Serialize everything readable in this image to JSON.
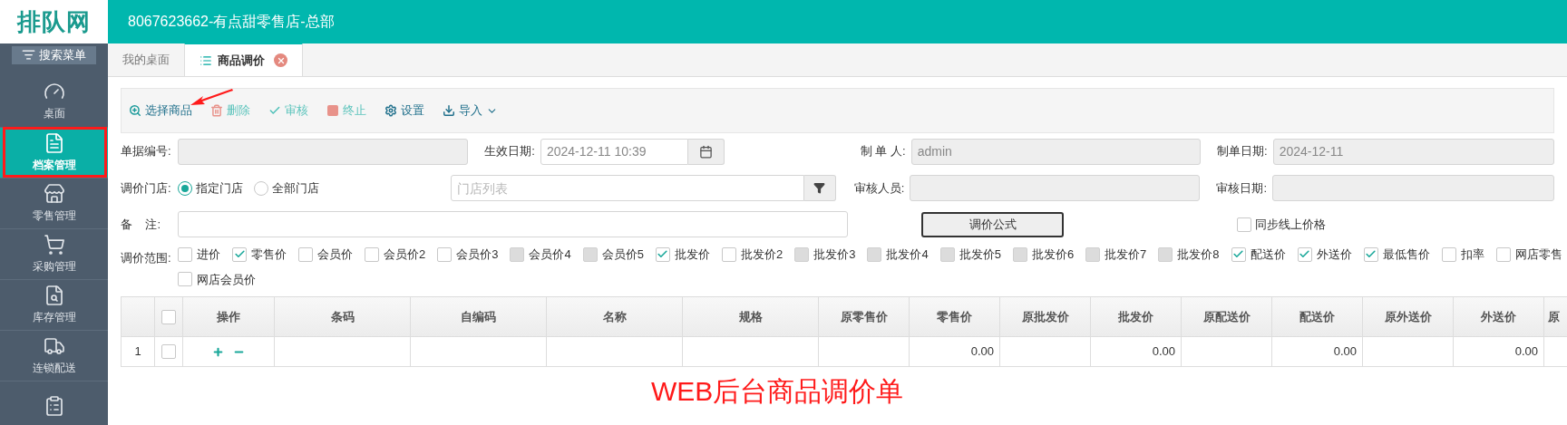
{
  "header": {
    "logo": "排队网",
    "title": "8067623662-有点甜零售店-总部"
  },
  "sidebar": {
    "search_button": "搜索菜单",
    "items": [
      {
        "label": "桌面",
        "selected": false,
        "annotated": false
      },
      {
        "label": "档案管理",
        "selected": true,
        "annotated": true
      },
      {
        "label": "零售管理",
        "selected": false,
        "annotated": false
      },
      {
        "label": "采购管理",
        "selected": false,
        "annotated": false
      },
      {
        "label": "库存管理",
        "selected": false,
        "annotated": false
      },
      {
        "label": "连锁配送",
        "selected": false,
        "annotated": false
      },
      {
        "selected": false,
        "annotated": false
      }
    ]
  },
  "tabs": [
    {
      "label": "我的桌面",
      "selected": false,
      "closable": false
    },
    {
      "label": "商品调价",
      "selected": true,
      "closable": true
    }
  ],
  "toolbar": [
    {
      "label": "选择商品",
      "disabled": false,
      "annotated": true,
      "dropdown": false
    },
    {
      "label": "删除",
      "disabled": true,
      "annotated": false,
      "dropdown": false
    },
    {
      "label": "审核",
      "disabled": true,
      "annotated": false,
      "dropdown": false
    },
    {
      "label": "终止",
      "disabled": true,
      "annotated": false,
      "dropdown": false
    },
    {
      "label": "设置",
      "disabled": false,
      "annotated": false,
      "dropdown": false
    },
    {
      "label": "导入",
      "disabled": false,
      "annotated": false,
      "dropdown": true
    }
  ],
  "form": {
    "doc_number": {
      "label": "单据编号:",
      "readonly": true
    },
    "effective_date": {
      "label": "生效日期:",
      "value": "2024-12-11 10:39",
      "readonly": false
    },
    "creator": {
      "label": "制 单 人:",
      "value": "admin",
      "readonly": true
    },
    "created_date": {
      "label": "制单日期:",
      "value": "2024-12-11",
      "readonly": true
    },
    "store_scope": {
      "label": "调价门店:",
      "options": [
        {
          "label": "指定门店",
          "selected": true
        },
        {
          "label": "全部门店",
          "selected": false
        }
      ]
    },
    "store_list": {
      "placeholder": "门店列表",
      "readonly": false
    },
    "reviewer": {
      "label": "审核人员:",
      "readonly": true
    },
    "review_date": {
      "label": "审核日期:",
      "readonly": true
    },
    "remark": {
      "label": "备    注:",
      "readonly": false
    },
    "formula_button": "调价公式",
    "sync_online": {
      "label": "同步线上价格",
      "checked": false
    }
  },
  "price_scope": {
    "label": "调价范围:",
    "rows": [
      [
        {
          "label": "进价",
          "checked": false,
          "disabled": false
        },
        {
          "label": "零售价",
          "checked": true,
          "disabled": false
        },
        {
          "label": "会员价",
          "checked": false,
          "disabled": false
        },
        {
          "label": "会员价2",
          "checked": false,
          "disabled": false
        },
        {
          "label": "会员价3",
          "checked": false,
          "disabled": false
        },
        {
          "label": "会员价4",
          "checked": false,
          "disabled": true
        },
        {
          "label": "会员价5",
          "checked": false,
          "disabled": true
        },
        {
          "label": "批发价",
          "checked": true,
          "disabled": false
        },
        {
          "label": "批发价2",
          "checked": false,
          "disabled": false
        },
        {
          "label": "批发价3",
          "checked": false,
          "disabled": true
        },
        {
          "label": "批发价4",
          "checked": false,
          "disabled": true
        },
        {
          "label": "批发价5",
          "checked": false,
          "disabled": true
        },
        {
          "label": "批发价6",
          "checked": false,
          "disabled": true
        },
        {
          "label": "批发价7",
          "checked": false,
          "disabled": true
        },
        {
          "label": "批发价8",
          "checked": false,
          "disabled": true
        },
        {
          "label": "配送价",
          "checked": true,
          "disabled": false
        },
        {
          "label": "外送价",
          "checked": true,
          "disabled": false
        },
        {
          "label": "最低售价",
          "checked": true,
          "disabled": false
        },
        {
          "label": "扣率",
          "checked": false,
          "disabled": false
        },
        {
          "label": "网店零售",
          "checked": false,
          "disabled": false
        }
      ],
      [
        {
          "label": "网店会员价",
          "checked": false,
          "disabled": false
        }
      ]
    ]
  },
  "table": {
    "header_checked": false,
    "columns": [
      {
        "label": "操作",
        "kind": "ops"
      },
      {
        "label": "条码",
        "kind": "text"
      },
      {
        "label": "自编码",
        "kind": "text"
      },
      {
        "label": "名称",
        "kind": "text"
      },
      {
        "label": "规格",
        "kind": "text"
      },
      {
        "label": "原零售价",
        "kind": "original"
      },
      {
        "label": "零售价",
        "kind": "value"
      },
      {
        "label": "原批发价",
        "kind": "original"
      },
      {
        "label": "批发价",
        "kind": "value"
      },
      {
        "label": "原配送价",
        "kind": "original"
      },
      {
        "label": "配送价",
        "kind": "value"
      },
      {
        "label": "原外送价",
        "kind": "original"
      },
      {
        "label": "外送价",
        "kind": "value"
      },
      {
        "label": "原",
        "kind": "last"
      }
    ],
    "rows": [
      {
        "number": "1",
        "checked": false,
        "values": [
          "0.00",
          "0.00",
          "0.00",
          "0.00"
        ]
      }
    ]
  },
  "annotation": {
    "caption": "WEB后台商品调价单"
  }
}
